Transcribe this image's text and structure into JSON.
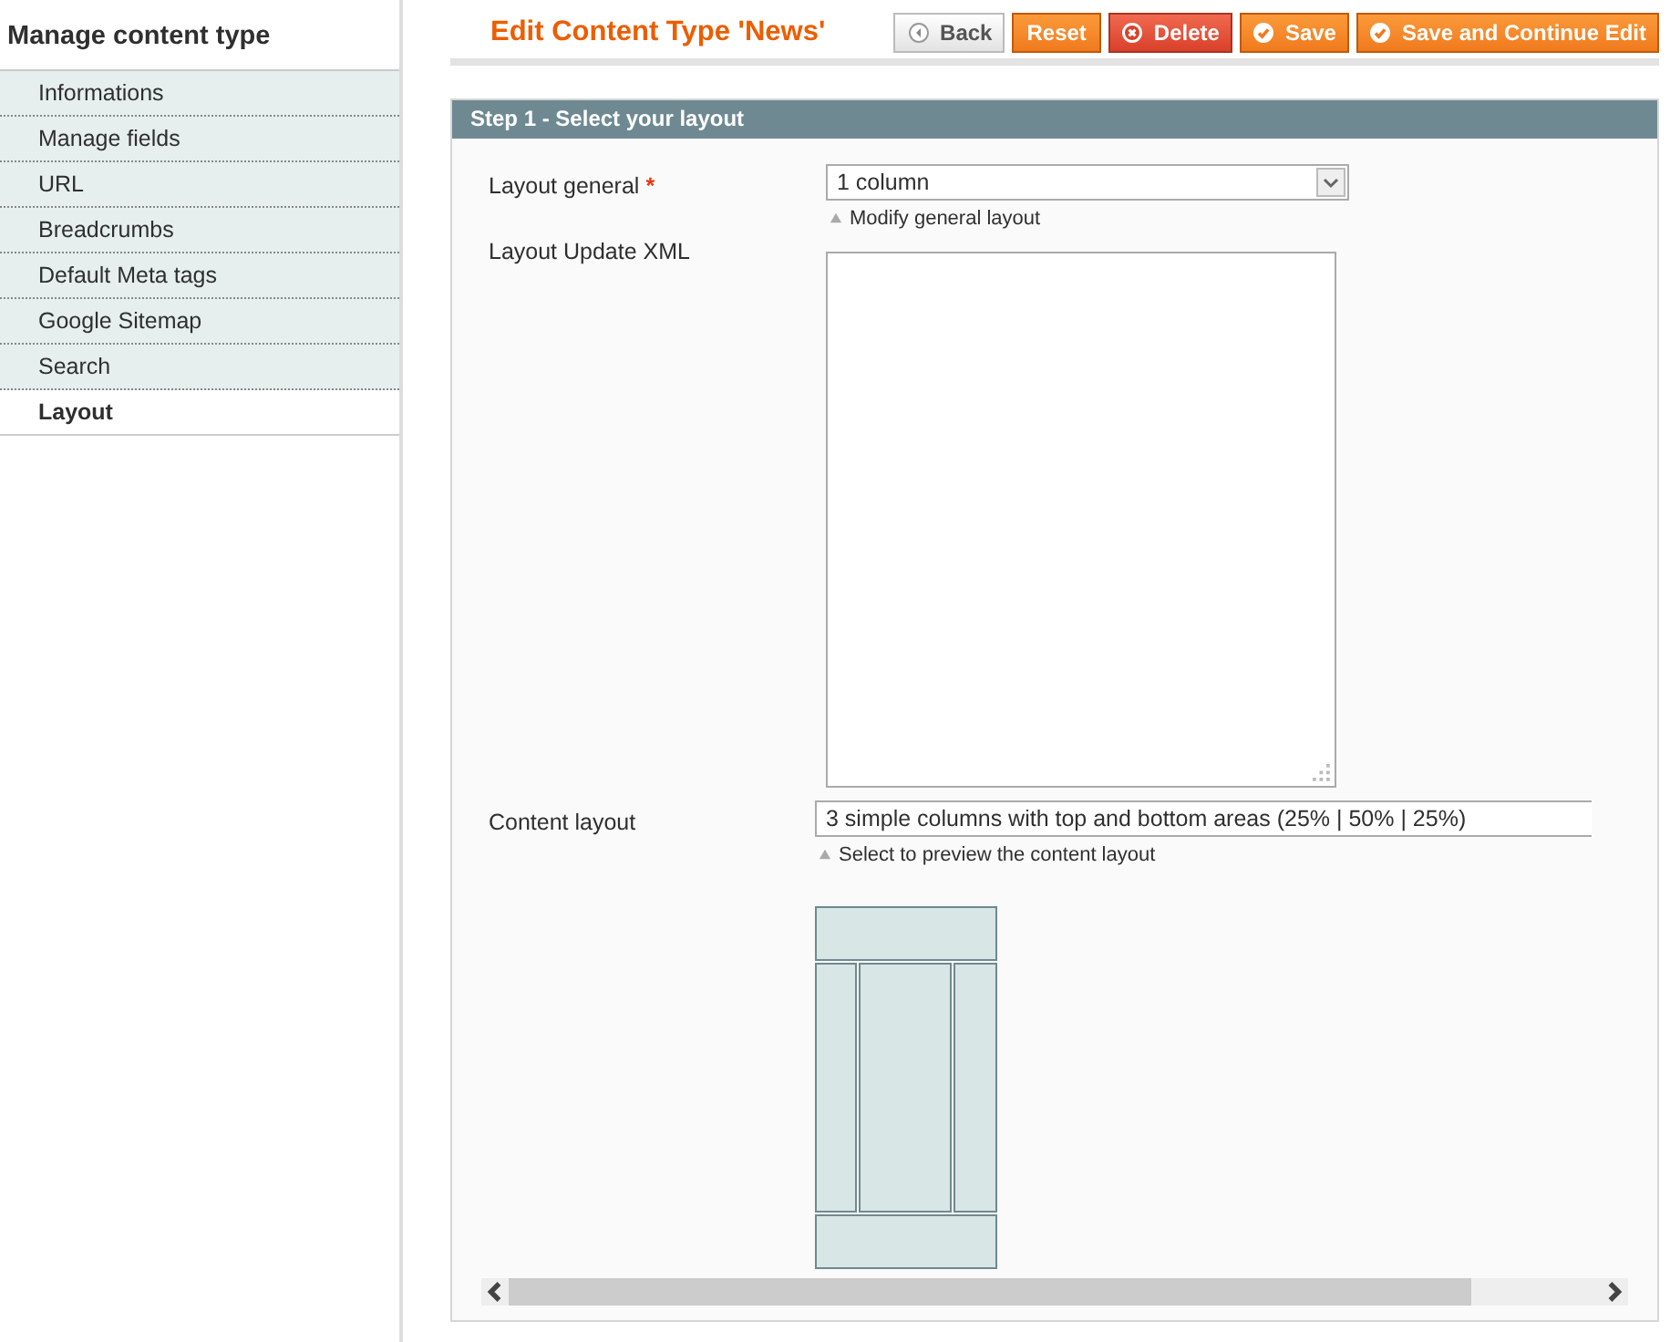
{
  "sidebar": {
    "title": "Manage content type",
    "items": [
      {
        "label": "Informations",
        "selected": false
      },
      {
        "label": "Manage fields",
        "selected": false
      },
      {
        "label": "URL",
        "selected": false
      },
      {
        "label": "Breadcrumbs",
        "selected": false
      },
      {
        "label": "Default Meta tags",
        "selected": false
      },
      {
        "label": "Google Sitemap",
        "selected": false
      },
      {
        "label": "Search",
        "selected": false
      },
      {
        "label": "Layout",
        "selected": true
      }
    ]
  },
  "header": {
    "title": "Edit Content Type 'News'",
    "buttons": [
      {
        "label": "Back",
        "kind": "back"
      },
      {
        "label": "Reset",
        "kind": "plain"
      },
      {
        "label": "Delete",
        "kind": "delete"
      },
      {
        "label": "Save",
        "kind": "save"
      },
      {
        "label": "Save and Continue Edit",
        "kind": "save"
      }
    ]
  },
  "section": {
    "title": "Step 1 - Select your layout",
    "layout_general": {
      "label": "Layout general",
      "required_mark": "*",
      "value": "1 column",
      "hint": "Modify general layout"
    },
    "layout_update_xml": {
      "label": "Layout Update XML"
    },
    "content_layout": {
      "label": "Content layout",
      "value": "3 simple columns with top and bottom areas (25% | 50% | 25%)",
      "hint": "Select to preview the content layout"
    }
  }
}
